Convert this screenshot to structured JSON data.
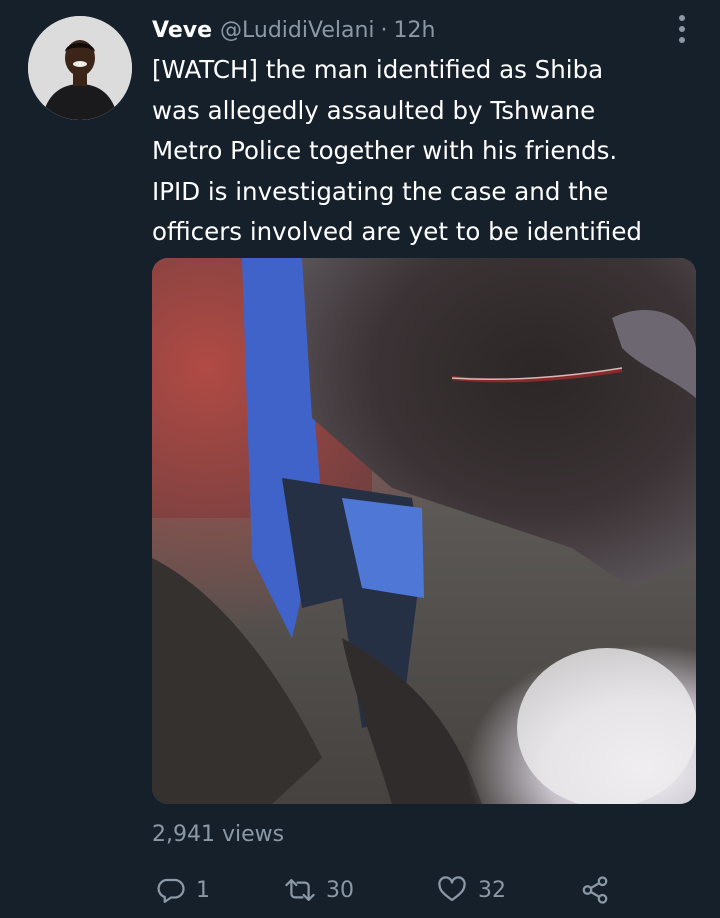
{
  "tweet": {
    "author_name": "Veve",
    "author_handle": "@LudidiVelani",
    "separator": "·",
    "timestamp": "12h",
    "text": "[WATCH] the man identified as Shiba\nwas allegedly assaulted by Tshwane\nMetro Police together with his friends.\nIPID is investigating the case and the\nofficers involved are yet to be identified",
    "views": "2,941 views"
  },
  "actions": {
    "reply_count": "1",
    "retweet_count": "30",
    "like_count": "32"
  },
  "icons": {
    "more": "more-vertical-icon",
    "reply": "reply-icon",
    "retweet": "retweet-icon",
    "like": "heart-icon",
    "share": "share-icon"
  },
  "colors": {
    "background": "#15202b",
    "text_primary": "#ffffff",
    "text_secondary": "#8b98a5"
  }
}
